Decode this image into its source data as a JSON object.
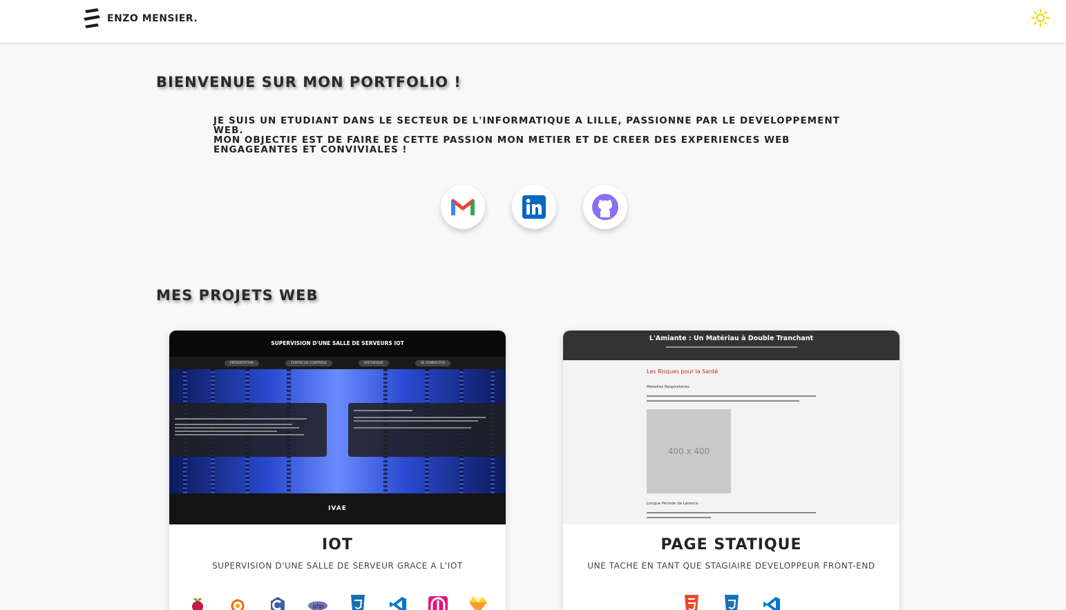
{
  "header": {
    "logo_text": "ENZO MENSIER.",
    "theme_toggle_icon": "sun-icon",
    "theme_color": "#e8d900"
  },
  "welcome": {
    "title": "Bienvenue sur mon portfolio !",
    "line1": "Je suis un etudiant dans le secteur de l'informatique a Lille, passionne par le developpement web.",
    "line2": "Mon objectif est de faire de cette passion mon metier et de creer des experiences web engageantes et conviviales !"
  },
  "socials": [
    {
      "name": "gmail",
      "icon": "gmail-icon"
    },
    {
      "name": "linkedin",
      "icon": "linkedin-icon"
    },
    {
      "name": "github",
      "icon": "github-icon"
    }
  ],
  "projects": {
    "title": "Mes projets web",
    "items": [
      {
        "title": "IoT",
        "subtitle": "Supervision d'une salle de serveur grace a l'IoT",
        "preview": {
          "header": "SUPERVISION D'UNE SALLE DE SERVEURS IOT",
          "nav": [
            "PRÉSENTATION",
            "CENTRE DE CONTRÔLE",
            "HISTORIQUE",
            "SE CONNECTER"
          ],
          "footer": "IVAE"
        },
        "tech": [
          "raspberry-pi-icon",
          "grafana-icon",
          "c-icon",
          "php-icon",
          "css3-icon",
          "vscode-icon",
          "mqtt-icon",
          "sketch-icon"
        ]
      },
      {
        "title": "Page statique",
        "subtitle": "Une tache en tant que stagiaire developpeur front-end",
        "preview": {
          "header": "L'Amiante : Un Matériau à Double Tranchant",
          "section": "Les Risques pour la Santé",
          "sub1": "Maladies Respiratoires",
          "image_label": "400 x 400",
          "sub2": "Longue Période de Latence"
        },
        "tech": [
          "html5-icon",
          "css3-icon",
          "vscode-icon"
        ]
      }
    ]
  }
}
